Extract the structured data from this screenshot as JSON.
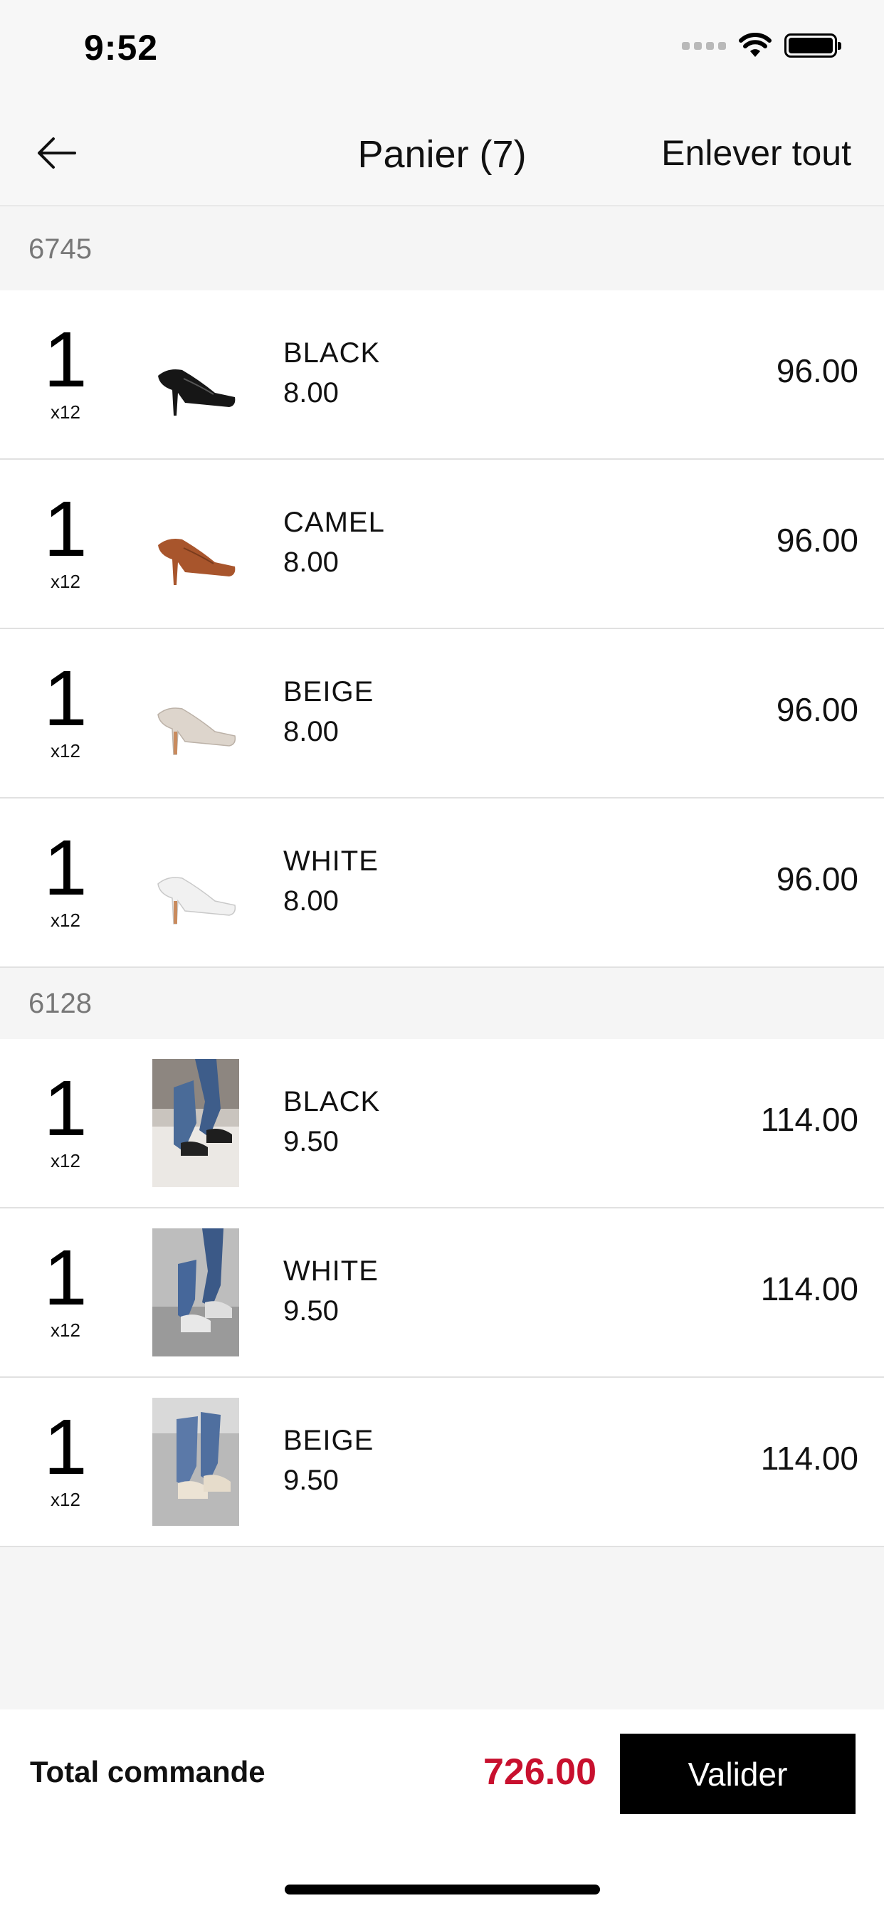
{
  "status_bar": {
    "time": "9:52"
  },
  "nav": {
    "title": "Panier (7)",
    "action": "Enlever tout"
  },
  "groups": [
    {
      "code": "6745",
      "items": [
        {
          "qty": "1",
          "pack": "x12",
          "color": "BLACK",
          "unit_price": "8.00",
          "line_total": "96.00",
          "image": "black-pump",
          "swatch": "#1a1a1a"
        },
        {
          "qty": "1",
          "pack": "x12",
          "color": "CAMEL",
          "unit_price": "8.00",
          "line_total": "96.00",
          "image": "camel-pump",
          "swatch": "#a8552c"
        },
        {
          "qty": "1",
          "pack": "x12",
          "color": "BEIGE",
          "unit_price": "8.00",
          "line_total": "96.00",
          "image": "beige-pump",
          "swatch": "#d9d1c8"
        },
        {
          "qty": "1",
          "pack": "x12",
          "color": "WHITE",
          "unit_price": "8.00",
          "line_total": "96.00",
          "image": "white-pump",
          "swatch": "#eeeeee"
        }
      ]
    },
    {
      "code": "6128",
      "items": [
        {
          "qty": "1",
          "pack": "x12",
          "color": "BLACK",
          "unit_price": "9.50",
          "line_total": "114.00",
          "image": "black-sneaker-photo",
          "swatch": "#222222"
        },
        {
          "qty": "1",
          "pack": "x12",
          "color": "WHITE",
          "unit_price": "9.50",
          "line_total": "114.00",
          "image": "white-sneaker-photo",
          "swatch": "#e6e6e6"
        },
        {
          "qty": "1",
          "pack": "x12",
          "color": "BEIGE",
          "unit_price": "9.50",
          "line_total": "114.00",
          "image": "beige-sneaker-photo",
          "swatch": "#d8cdbb"
        }
      ]
    }
  ],
  "footer": {
    "total_label": "Total commande",
    "total_value": "726.00",
    "validate_label": "Valider"
  },
  "colors": {
    "accent": "#c8102e",
    "button": "#000000",
    "background": "#f5f5f5"
  }
}
